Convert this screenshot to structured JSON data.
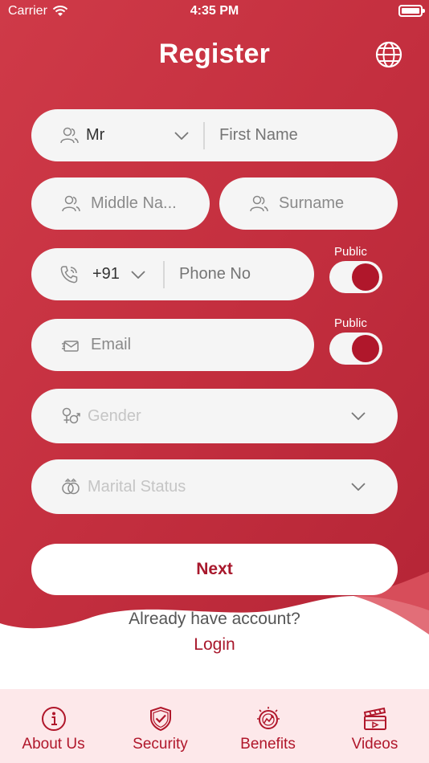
{
  "status_bar": {
    "carrier": "Carrier",
    "time": "4:35 PM"
  },
  "header": {
    "title": "Register",
    "language_icon": "globe-icon"
  },
  "form": {
    "salutation": {
      "value": "Mr",
      "icon": "user-icon"
    },
    "first_name": {
      "placeholder": "First Name"
    },
    "middle_name": {
      "placeholder": "Middle Na...",
      "icon": "user-icon"
    },
    "surname": {
      "placeholder": "Surname",
      "icon": "user-icon"
    },
    "phone_code": {
      "value": "+91",
      "icon": "phone-icon"
    },
    "phone": {
      "placeholder": "Phone No"
    },
    "phone_public": {
      "label": "Public",
      "on": true
    },
    "email": {
      "placeholder": "Email",
      "icon": "mail-icon"
    },
    "email_public": {
      "label": "Public",
      "on": true
    },
    "gender": {
      "placeholder": "Gender",
      "icon": "gender-icon"
    },
    "marital_status": {
      "placeholder": "Marital Status",
      "icon": "rings-icon"
    }
  },
  "actions": {
    "next_label": "Next",
    "already_text": "Already have account?",
    "login_label": "Login"
  },
  "tabbar": {
    "items": [
      {
        "label": "About Us",
        "icon": "info-icon"
      },
      {
        "label": "Security",
        "icon": "shield-check-icon"
      },
      {
        "label": "Benefits",
        "icon": "benefits-icon"
      },
      {
        "label": "Videos",
        "icon": "clapperboard-icon"
      }
    ]
  },
  "colors": {
    "primary": "#c62f40",
    "accent": "#b0172b",
    "field_bg": "#f5f5f5",
    "tabbar_bg": "#fde8ea"
  }
}
